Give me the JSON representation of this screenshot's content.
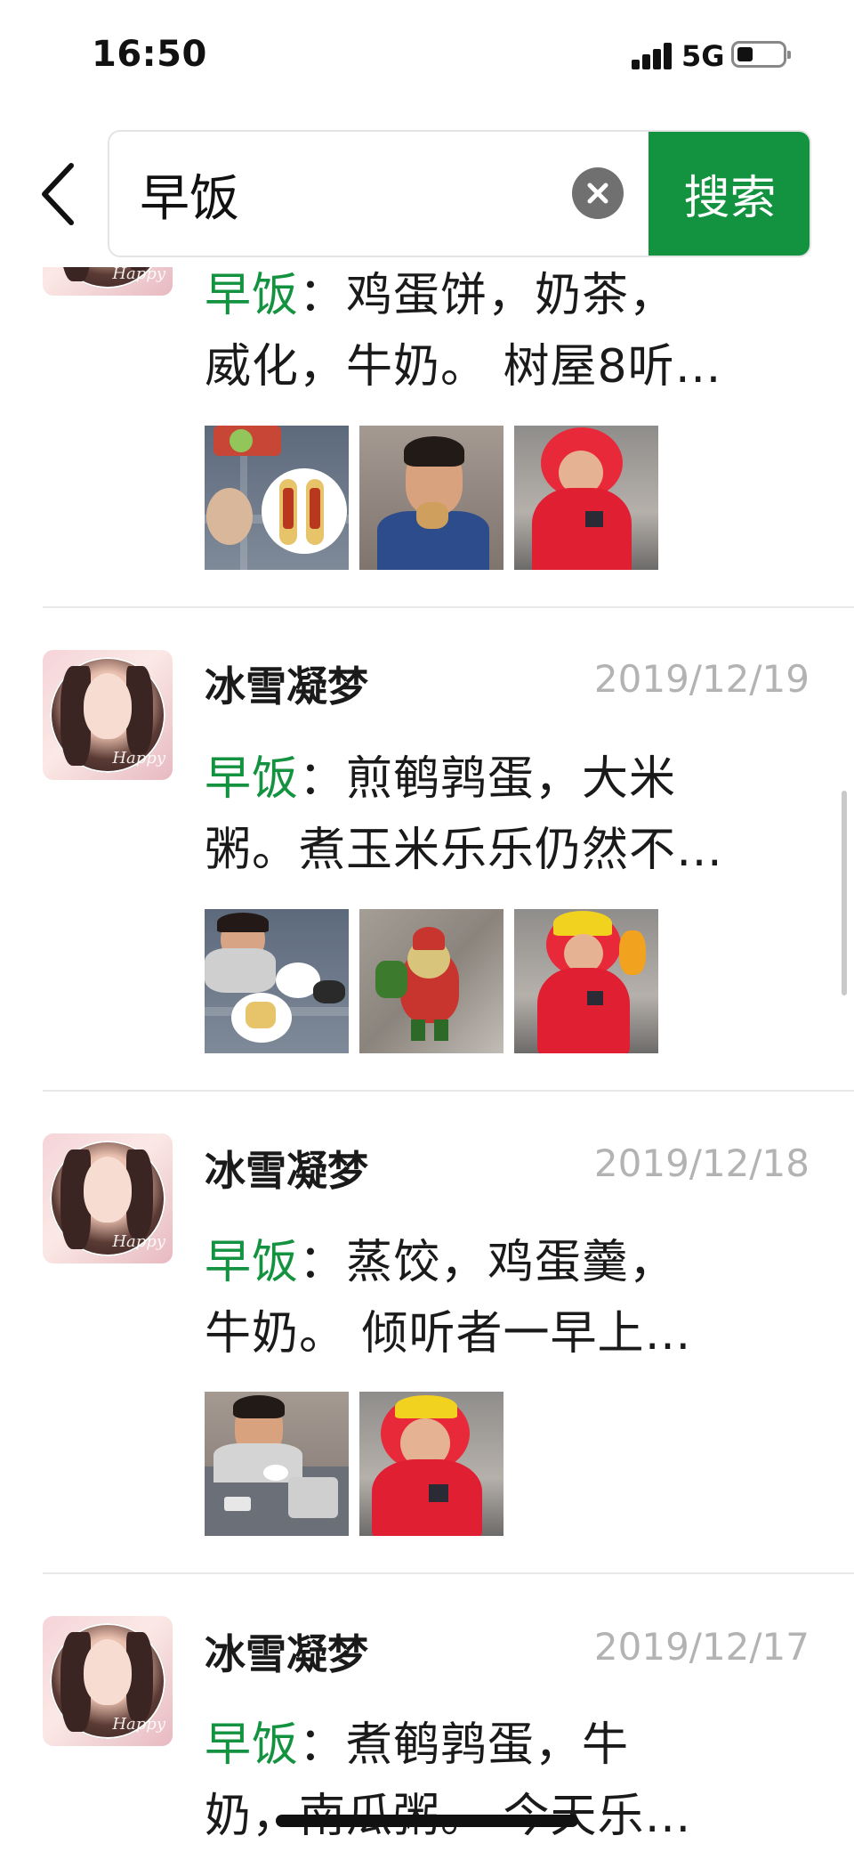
{
  "status_bar": {
    "time": "16:50",
    "network": "5G",
    "battery_level": 0.35
  },
  "search": {
    "query": "早饭",
    "search_label": "搜索",
    "back_icon": "chevron-left-icon",
    "clear_icon": "clear-circle-icon"
  },
  "colors": {
    "accent": "#13923f",
    "date_gray": "#b3b3b3",
    "divider": "#e8e8e8"
  },
  "results": [
    {
      "author": "",
      "date": "",
      "keyword": "早饭",
      "sep": "：",
      "line1_rest": "鸡蛋饼，奶茶，",
      "line2": "威化，牛奶。 树屋8听…",
      "images": [
        "breakfast-table-photo",
        "boy-eating-photo",
        "child-red-coat-photo"
      ]
    },
    {
      "author": "冰雪凝梦",
      "date": "2019/12/19",
      "keyword": "早饭",
      "sep": "：",
      "line1_rest": "煎鹌鹑蛋，大米",
      "line2": "粥。煮玉米乐乐仍然不…",
      "images": [
        "breakfast-table-photo",
        "santa-pin-photo",
        "child-red-coat-photo"
      ]
    },
    {
      "author": "冰雪凝梦",
      "date": "2019/12/18",
      "keyword": "早饭",
      "sep": "：",
      "line1_rest": "蒸饺，鸡蛋羹，",
      "line2": "牛奶。 倾听者一早上…",
      "images": [
        "boy-at-table-photo",
        "child-red-coat-photo"
      ]
    },
    {
      "author": "冰雪凝梦",
      "date": "2019/12/17",
      "keyword": "早饭",
      "sep": "：",
      "line1_rest": "煮鹌鹑蛋，牛",
      "line2": "奶，南瓜粥。 今天乐…",
      "images": []
    }
  ],
  "avatar_caption": "Happy"
}
